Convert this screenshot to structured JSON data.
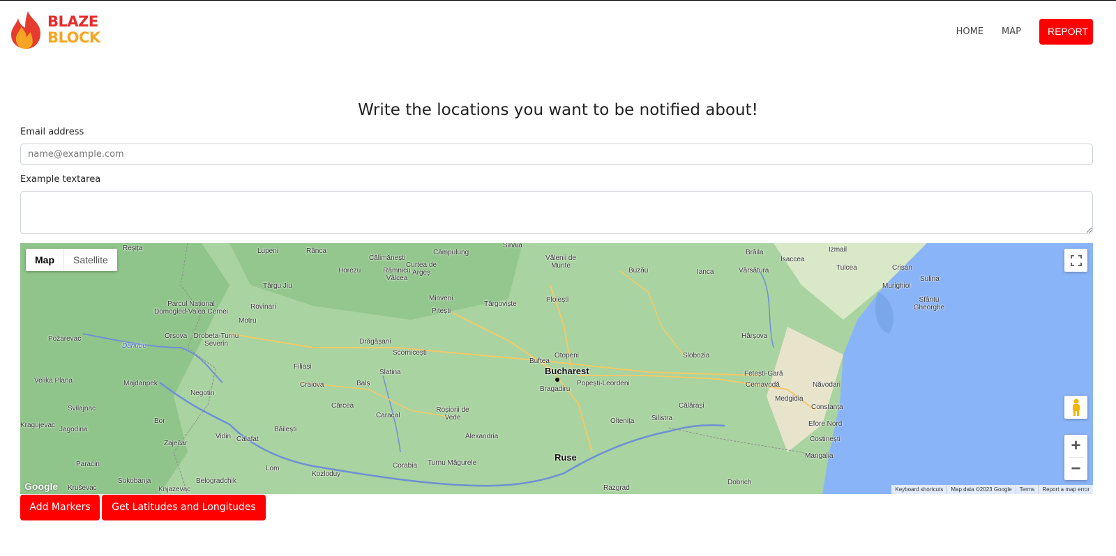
{
  "brand": {
    "line1": "BLAZE",
    "line2": "BLOCK"
  },
  "nav": {
    "home": "HOME",
    "map": "MAP",
    "report": "REPORT"
  },
  "page": {
    "heading": "Write the locations you want to be notified about!"
  },
  "form": {
    "email_label": "Email address",
    "email_placeholder": "name@example.com",
    "email_value": "",
    "textarea_label": "Example textarea",
    "textarea_value": ""
  },
  "map": {
    "type_active": "Map",
    "type_inactive": "Satellite",
    "attribution": [
      "Keyboard shortcuts",
      "Map data ©2023 Google",
      "Terms",
      "Report a map error"
    ],
    "google_logo": "Google",
    "places": [
      "Reșița",
      "Lupeni",
      "Rânca",
      "Călimănești",
      "Câmpulung",
      "Sinaia",
      "Vălenii de Munte",
      "Brăila",
      "Isaccea",
      "Izmail",
      "Horezu",
      "Râmnicu Vâlcea",
      "Curtea de Argeș",
      "Buzău",
      "Ianca",
      "Vărsătura",
      "Tulcea",
      "Crișan",
      "Sulina",
      "Târgu Jiu",
      "Parcul Național Domogled-Valea Cernei",
      "Rovinari",
      "Mioveni",
      "Pitești",
      "Târgoviște",
      "Ploiești",
      "Murighiol",
      "Sfântu Gheorghe",
      "Motru",
      "Orșova",
      "Drobeta-Turnu Severin",
      "Drăgășani",
      "Scornicești",
      "Otopeni",
      "Buftea",
      "Slobozia",
      "Hârșova",
      "Filiași",
      "Slatina",
      "Bucharest",
      "Bragadiru",
      "Popești-Leordeni",
      "Fetești-Gară",
      "Cernavodă",
      "Năvodari",
      "Craiova",
      "Balș",
      "Negotin",
      "Călărași",
      "Medgidia",
      "Constanța",
      "Cărcea",
      "Caracal",
      "Roșiorii de Vede",
      "Băilești",
      "Calafat",
      "Vidin",
      "Alexandria",
      "Oltenița",
      "Silistra",
      "Efore Nord",
      "Costinești",
      "Ruse",
      "Turnu Măgurele",
      "Corabia",
      "Lom",
      "Kozloduy",
      "Dobrich",
      "Mangalia",
      "Razgrad",
      "Danube",
      "Kragujevac",
      "Jagodina",
      "Paraćin",
      "Zaječar",
      "Bor",
      "Sokobanja",
      "Belogradchik",
      "Knjazevac",
      "Kruševac",
      "Svilajnac",
      "Velika Plana",
      "Majdanpek",
      "Požarevac"
    ]
  },
  "actions": {
    "add_markers": "Add Markers",
    "get_latlng": "Get Latitudes and Longitudes"
  },
  "colors": {
    "accent": "#ff0000",
    "map_land": "#a8d5a2",
    "map_water": "#8ab4f8"
  },
  "icons": {
    "fullscreen": "fullscreen-icon",
    "pegman": "pegman-icon",
    "zoom_in": "plus-icon",
    "zoom_out": "minus-icon",
    "logo": "flame-icon"
  }
}
